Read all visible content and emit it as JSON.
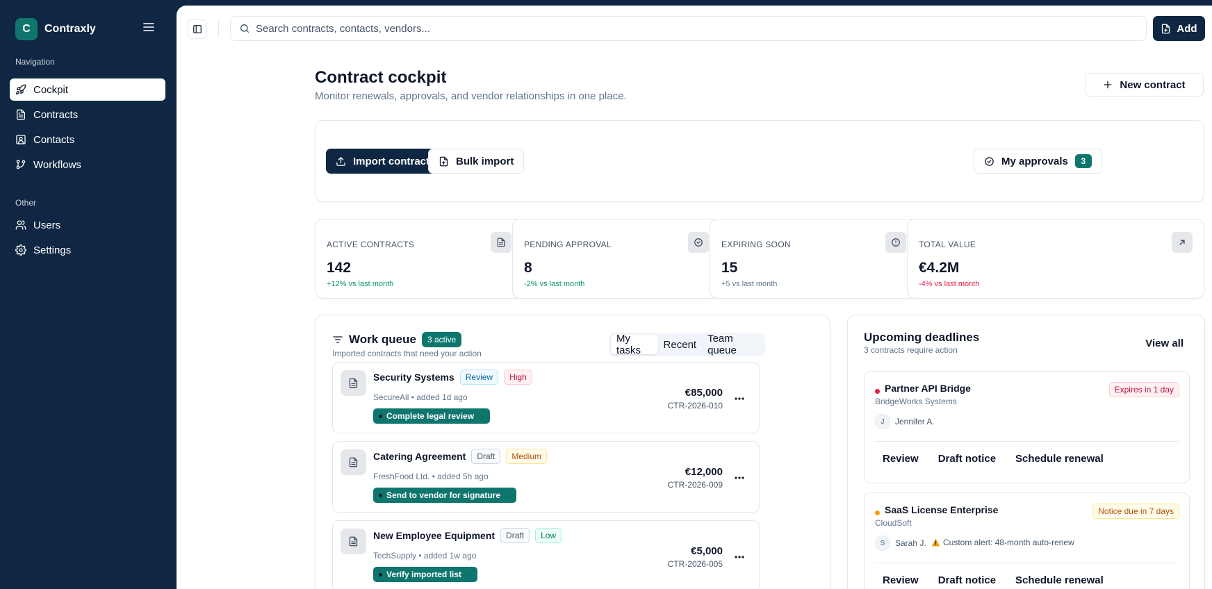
{
  "app": {
    "name": "Contraxly",
    "logo_letter": "C"
  },
  "sidebar": {
    "sections": [
      {
        "label": "Navigation",
        "items": [
          {
            "label": "Cockpit",
            "icon": "rocket-icon",
            "active": true
          },
          {
            "label": "Contracts",
            "icon": "file-text-icon"
          },
          {
            "label": "Contacts",
            "icon": "contact-card-icon"
          },
          {
            "label": "Workflows",
            "icon": "git-branch-icon"
          }
        ]
      },
      {
        "label": "Other",
        "items": [
          {
            "label": "Users",
            "icon": "users-icon"
          },
          {
            "label": "Settings",
            "icon": "gear-icon"
          }
        ]
      }
    ]
  },
  "topbar": {
    "search_placeholder": "Search contracts, contacts, vendors...",
    "add_label": "Add"
  },
  "page": {
    "title": "Contract cockpit",
    "subtitle": "Monitor renewals, approvals, and vendor relationships in one place.",
    "new_contract_label": "New contract"
  },
  "actions": {
    "import_label": "Import contract",
    "bulk_import_label": "Bulk import",
    "approvals_label": "My approvals",
    "approvals_count": "3"
  },
  "stats": [
    {
      "label": "ACTIVE CONTRACTS",
      "value": "142",
      "delta": "+12% vs last month",
      "trend": "up",
      "icon": "document-icon"
    },
    {
      "label": "PENDING APPROVAL",
      "value": "8",
      "delta": "-2% vs last month",
      "trend": "up",
      "icon": "check-circle-icon"
    },
    {
      "label": "EXPIRING SOON",
      "value": "15",
      "delta": "+5 vs last month",
      "trend": "neutral",
      "icon": "alert-circle-icon"
    },
    {
      "label": "TOTAL VALUE",
      "value": "€4.2M",
      "delta": "-4% vs last month",
      "trend": "down",
      "icon": "arrow-up-right-icon"
    }
  ],
  "work_queue": {
    "title": "Work queue",
    "active_badge": "3 active",
    "subtitle": "Imported contracts that need your action",
    "tabs": [
      {
        "label": "My tasks",
        "active": true
      },
      {
        "label": "Recent"
      },
      {
        "label": "Team queue"
      }
    ],
    "items": [
      {
        "title": "Security Systems",
        "status": "Review",
        "priority": "High",
        "meta": "SecureAll • added 1d ago",
        "task": "Complete legal review",
        "amount": "€85,000",
        "code": "CTR-2026-010"
      },
      {
        "title": "Catering Agreement",
        "status": "Draft",
        "priority": "Medium",
        "meta": "FreshFood Ltd. • added 5h ago",
        "task": "Send to vendor for signature",
        "amount": "€12,000",
        "code": "CTR-2026-009"
      },
      {
        "title": "New Employee Equipment",
        "status": "Draft",
        "priority": "Low",
        "meta": "TechSupply • added 1w ago",
        "task": "Verify imported list",
        "amount": "€5,000",
        "code": "CTR-2026-005"
      }
    ]
  },
  "deadlines": {
    "title": "Upcoming deadlines",
    "subtitle": "3 contracts require action",
    "view_all": "View all",
    "items": [
      {
        "name": "Partner API Bridge",
        "vendor": "BridgeWorks Systems",
        "pill": "Expires in 1 day",
        "severity": "critical",
        "initial": "J",
        "person": "Jennifer A.",
        "alert": "",
        "actions": [
          "Review",
          "Draft notice",
          "Schedule renewal"
        ]
      },
      {
        "name": "SaaS License Enterprise",
        "vendor": "CloudSoft",
        "pill": "Notice due in 7 days",
        "severity": "warning",
        "initial": "S",
        "person": "Sarah J.",
        "alert": "Custom alert: 48-month auto-renew",
        "actions": [
          "Review",
          "Draft notice",
          "Schedule renewal"
        ]
      }
    ]
  },
  "colors": {
    "sidebar_bg": "#0f2742",
    "accent_teal": "#0f766e",
    "positive": "#059669",
    "negative": "#e11d48",
    "neutral": "#64748b"
  }
}
